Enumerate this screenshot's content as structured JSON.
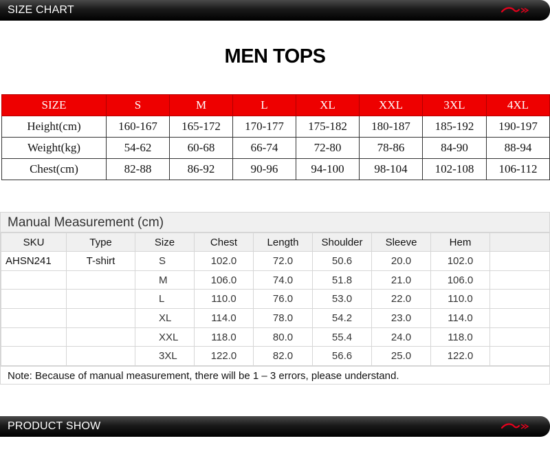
{
  "banners": {
    "top_title": "SIZE CHART",
    "bottom_title": "PRODUCT SHOW",
    "logo_color": "#e8001c"
  },
  "main_title": "MEN TOPS",
  "size_chart": {
    "header_color": "#ee0000",
    "header": [
      "SIZE",
      "S",
      "M",
      "L",
      "XL",
      "XXL",
      "3XL",
      "4XL"
    ],
    "rows": [
      [
        "Height(cm)",
        "160-167",
        "165-172",
        "170-177",
        "175-182",
        "180-187",
        "185-192",
        "190-197"
      ],
      [
        "Weight(kg)",
        "54-62",
        "60-68",
        "66-74",
        "72-80",
        "78-86",
        "84-90",
        "88-94"
      ],
      [
        "Chest(cm)",
        "82-88",
        "86-92",
        "90-96",
        "94-100",
        "98-104",
        "102-108",
        "106-112"
      ]
    ]
  },
  "manual": {
    "title": "Manual Measurement (cm)",
    "columns": [
      "SKU",
      "Type",
      "Size",
      "Chest",
      "Length",
      "Shoulder",
      "Sleeve",
      "Hem",
      ""
    ],
    "rows": [
      [
        "AHSN241",
        "T-shirt",
        "S",
        "102.0",
        "72.0",
        "50.6",
        "20.0",
        "102.0",
        ""
      ],
      [
        "",
        "",
        "M",
        "106.0",
        "74.0",
        "51.8",
        "21.0",
        "106.0",
        ""
      ],
      [
        "",
        "",
        "L",
        "110.0",
        "76.0",
        "53.0",
        "22.0",
        "110.0",
        ""
      ],
      [
        "",
        "",
        "XL",
        "114.0",
        "78.0",
        "54.2",
        "23.0",
        "114.0",
        ""
      ],
      [
        "",
        "",
        "XXL",
        "118.0",
        "80.0",
        "55.4",
        "24.0",
        "118.0",
        ""
      ],
      [
        "",
        "",
        "3XL",
        "122.0",
        "82.0",
        "56.6",
        "25.0",
        "122.0",
        ""
      ]
    ],
    "note": "Note: Because of manual measurement, there will be 1 – 3 errors, please understand."
  }
}
